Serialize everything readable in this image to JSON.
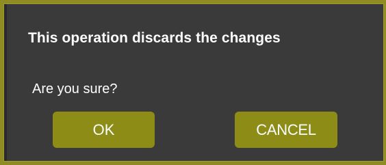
{
  "dialog": {
    "title": "This operation discards the changes",
    "message": "Are you sure?",
    "ok_label": "OK",
    "cancel_label": "CANCEL"
  },
  "colors": {
    "frame": "#8f8c24",
    "dialog_background": "#3a3a3a",
    "button_background": "#8c8c17",
    "text": "#ffffff"
  }
}
